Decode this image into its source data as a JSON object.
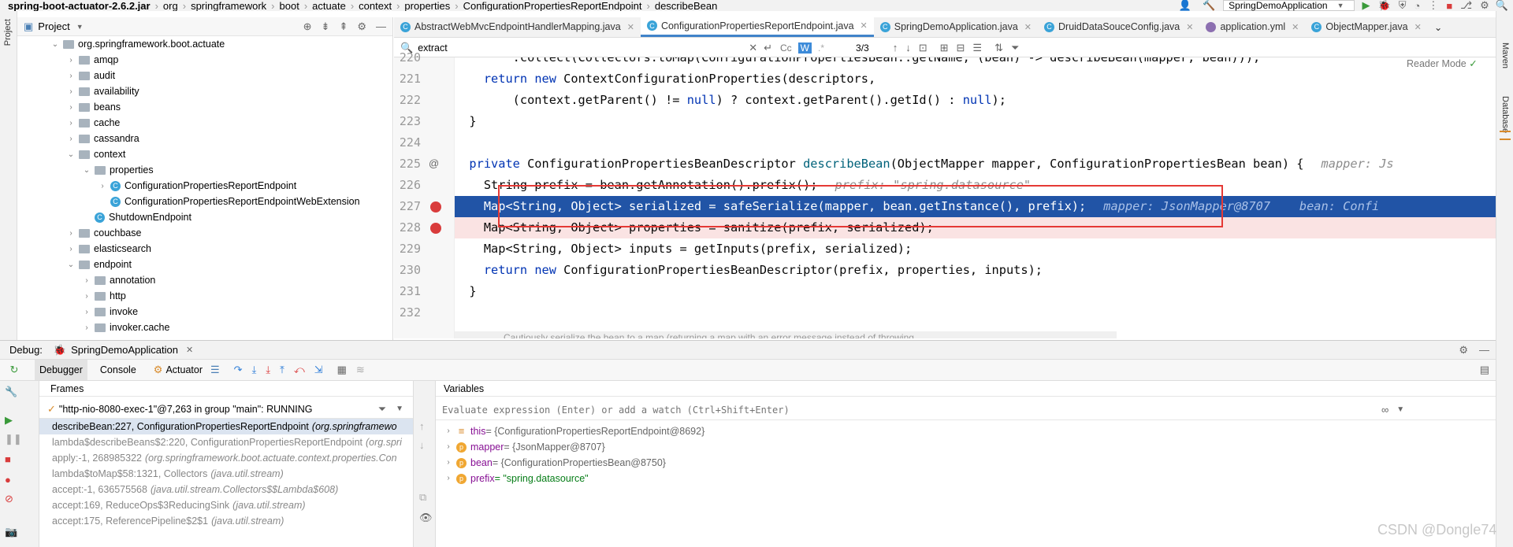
{
  "breadcrumb": [
    "spring-boot-actuator-2.6.2.jar",
    "org",
    "springframework",
    "boot",
    "actuate",
    "context",
    "properties",
    "ConfigurationPropertiesReportEndpoint",
    "describeBean"
  ],
  "run_config": "SpringDemoApplication",
  "stripes": {
    "left": "Project",
    "right_top": "Maven",
    "right_db": "Database"
  },
  "project": {
    "title": "Project",
    "items": [
      {
        "label": "org.springframework.boot.actuate",
        "depth": 0,
        "kind": "package",
        "open": true
      },
      {
        "label": "amqp",
        "depth": 1,
        "kind": "folder",
        "open": false
      },
      {
        "label": "audit",
        "depth": 1,
        "kind": "folder",
        "open": false
      },
      {
        "label": "availability",
        "depth": 1,
        "kind": "folder",
        "open": false
      },
      {
        "label": "beans",
        "depth": 1,
        "kind": "folder",
        "open": false
      },
      {
        "label": "cache",
        "depth": 1,
        "kind": "folder",
        "open": false
      },
      {
        "label": "cassandra",
        "depth": 1,
        "kind": "folder",
        "open": false
      },
      {
        "label": "context",
        "depth": 1,
        "kind": "folder",
        "open": true
      },
      {
        "label": "properties",
        "depth": 2,
        "kind": "folder",
        "open": true
      },
      {
        "label": "ConfigurationPropertiesReportEndpoint",
        "depth": 3,
        "kind": "class",
        "open": false
      },
      {
        "label": "ConfigurationPropertiesReportEndpointWebExtension",
        "depth": 3,
        "kind": "class",
        "leaf": true
      },
      {
        "label": "ShutdownEndpoint",
        "depth": 2,
        "kind": "class",
        "leaf": true
      },
      {
        "label": "couchbase",
        "depth": 1,
        "kind": "folder",
        "open": false
      },
      {
        "label": "elasticsearch",
        "depth": 1,
        "kind": "folder",
        "open": false
      },
      {
        "label": "endpoint",
        "depth": 1,
        "kind": "folder",
        "open": true
      },
      {
        "label": "annotation",
        "depth": 2,
        "kind": "folder",
        "open": false
      },
      {
        "label": "http",
        "depth": 2,
        "kind": "folder",
        "open": false
      },
      {
        "label": "invoke",
        "depth": 2,
        "kind": "folder",
        "open": false
      },
      {
        "label": "invoker.cache",
        "depth": 2,
        "kind": "folder",
        "open": false
      }
    ]
  },
  "tabs": [
    {
      "label": "AbstractWebMvcEndpointHandlerMapping.java",
      "active": false
    },
    {
      "label": "ConfigurationPropertiesReportEndpoint.java",
      "active": true
    },
    {
      "label": "SpringDemoApplication.java",
      "active": false
    },
    {
      "label": "DruidDataSouceConfig.java",
      "active": false
    },
    {
      "label": "application.yml",
      "active": false
    },
    {
      "label": "ObjectMapper.java",
      "active": false
    }
  ],
  "find": {
    "query": "extract",
    "count": "3/3",
    "cc": "Cc",
    "w": "W",
    "regex": ".*"
  },
  "reader_mode": "Reader Mode",
  "code": {
    "lines": [
      {
        "n": "220",
        "text": ".collect(Collectors.toMap(ConfigurationPropertiesBean::getName, (bean) -> describeBean(mapper, bean)));"
      },
      {
        "n": "221",
        "text": "return new ContextConfigurationProperties(descriptors,"
      },
      {
        "n": "222",
        "text": "(context.getParent() != null) ? context.getParent().getId() : null);"
      },
      {
        "n": "223",
        "text": "}"
      },
      {
        "n": "224",
        "text": ""
      },
      {
        "n": "225",
        "text": "private ConfigurationPropertiesBeanDescriptor describeBean(ObjectMapper mapper, ConfigurationPropertiesBean bean) {",
        "hint": "mapper: Js"
      },
      {
        "n": "226",
        "text": "String prefix = bean.getAnnotation().prefix();",
        "hint": "prefix: \"spring.datasource\""
      },
      {
        "n": "227",
        "text": "Map<String, Object> serialized = safeSerialize(mapper, bean.getInstance(), prefix);",
        "hint": "mapper: JsonMapper@8707    bean: Confi"
      },
      {
        "n": "228",
        "text": "Map<String, Object> properties = sanitize(prefix, serialized);"
      },
      {
        "n": "229",
        "text": "Map<String, Object> inputs = getInputs(prefix, serialized);"
      },
      {
        "n": "230",
        "text": "return new ConfigurationPropertiesBeanDescriptor(prefix, properties, inputs);"
      },
      {
        "n": "231",
        "text": "}"
      },
      {
        "n": "232",
        "text": ""
      }
    ],
    "doc_hint": "Cautiously serialize the bean to a map (returning a map with an error message instead of throwing"
  },
  "debug": {
    "label": "Debug:",
    "session": "SpringDemoApplication",
    "tabs": [
      "Debugger",
      "Console",
      "Actuator"
    ],
    "frames_title": "Frames",
    "variables_title": "Variables",
    "thread": "\"http-nio-8080-exec-1\"@7,263 in group \"main\": RUNNING",
    "frames": [
      {
        "m": "describeBean:227, ConfigurationPropertiesReportEndpoint",
        "p": "(org.springframewo"
      },
      {
        "m": "lambda$describeBeans$2:220, ConfigurationPropertiesReportEndpoint",
        "p": "(org.spri"
      },
      {
        "m": "apply:-1, 268985322",
        "p": "(org.springframework.boot.actuate.context.properties.Con"
      },
      {
        "m": "lambda$toMap$58:1321, Collectors",
        "p": "(java.util.stream)"
      },
      {
        "m": "accept:-1, 636575568",
        "p": "(java.util.stream.Collectors$$Lambda$608)"
      },
      {
        "m": "accept:169, ReduceOps$3ReducingSink",
        "p": "(java.util.stream)"
      },
      {
        "m": "accept:175, ReferencePipeline$2$1",
        "p": "(java.util.stream)"
      }
    ],
    "eval_placeholder": "Evaluate expression (Enter) or add a watch (Ctrl+Shift+Enter)",
    "vars": [
      {
        "badge": "≡",
        "name": "this",
        "value": " = {ConfigurationPropertiesReportEndpoint@8692}",
        "expand": true
      },
      {
        "badge": "p",
        "name": "mapper",
        "value": " = {JsonMapper@8707}",
        "expand": true
      },
      {
        "badge": "p",
        "name": "bean",
        "value": " = {ConfigurationPropertiesBean@8750}",
        "expand": true
      },
      {
        "badge": "p",
        "name": "prefix",
        "value": " = \"spring.datasource\"",
        "expand": true
      }
    ]
  },
  "watermark": "CSDN @Dongle74",
  "colors": {
    "accent": "#4083c9",
    "highlight": "#2154a6",
    "breakpoint": "#d93c3c",
    "box": "#e53935"
  }
}
